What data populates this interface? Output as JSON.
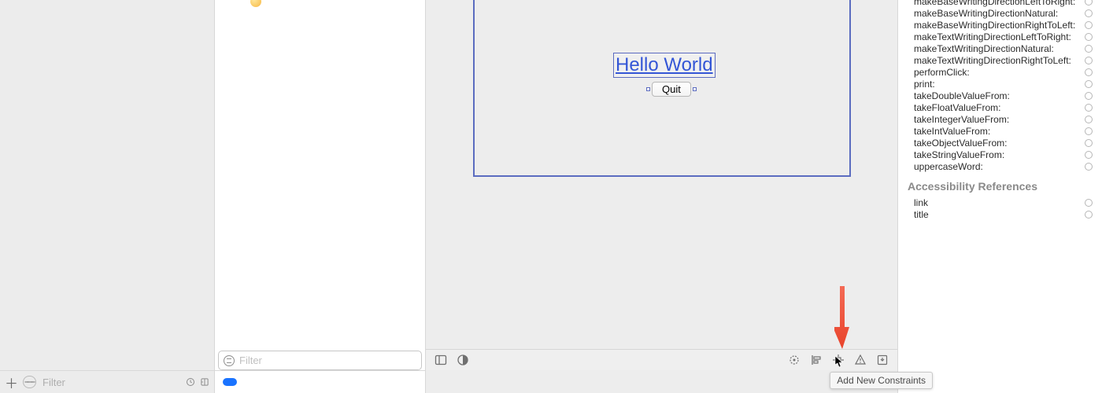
{
  "navigator": {
    "filter_placeholder": "Filter"
  },
  "outline": {
    "filter_placeholder": "Filter"
  },
  "canvas": {
    "label_text": "Hello World",
    "button_text": "Quit",
    "tooltip": "Add New Constraints"
  },
  "inspector": {
    "actions": [
      "makeBaseWritingDirectionLeftToRight:",
      "makeBaseWritingDirectionNatural:",
      "makeBaseWritingDirectionRightToLeft:",
      "makeTextWritingDirectionLeftToRight:",
      "makeTextWritingDirectionNatural:",
      "makeTextWritingDirectionRightToLeft:",
      "performClick:",
      "print:",
      "takeDoubleValueFrom:",
      "takeFloatValueFrom:",
      "takeIntegerValueFrom:",
      "takeIntValueFrom:",
      "takeObjectValueFrom:",
      "takeStringValueFrom:",
      "uppercaseWord:"
    ],
    "accessibility_header": "Accessibility References",
    "accessibility_refs": [
      "link",
      "title"
    ]
  }
}
